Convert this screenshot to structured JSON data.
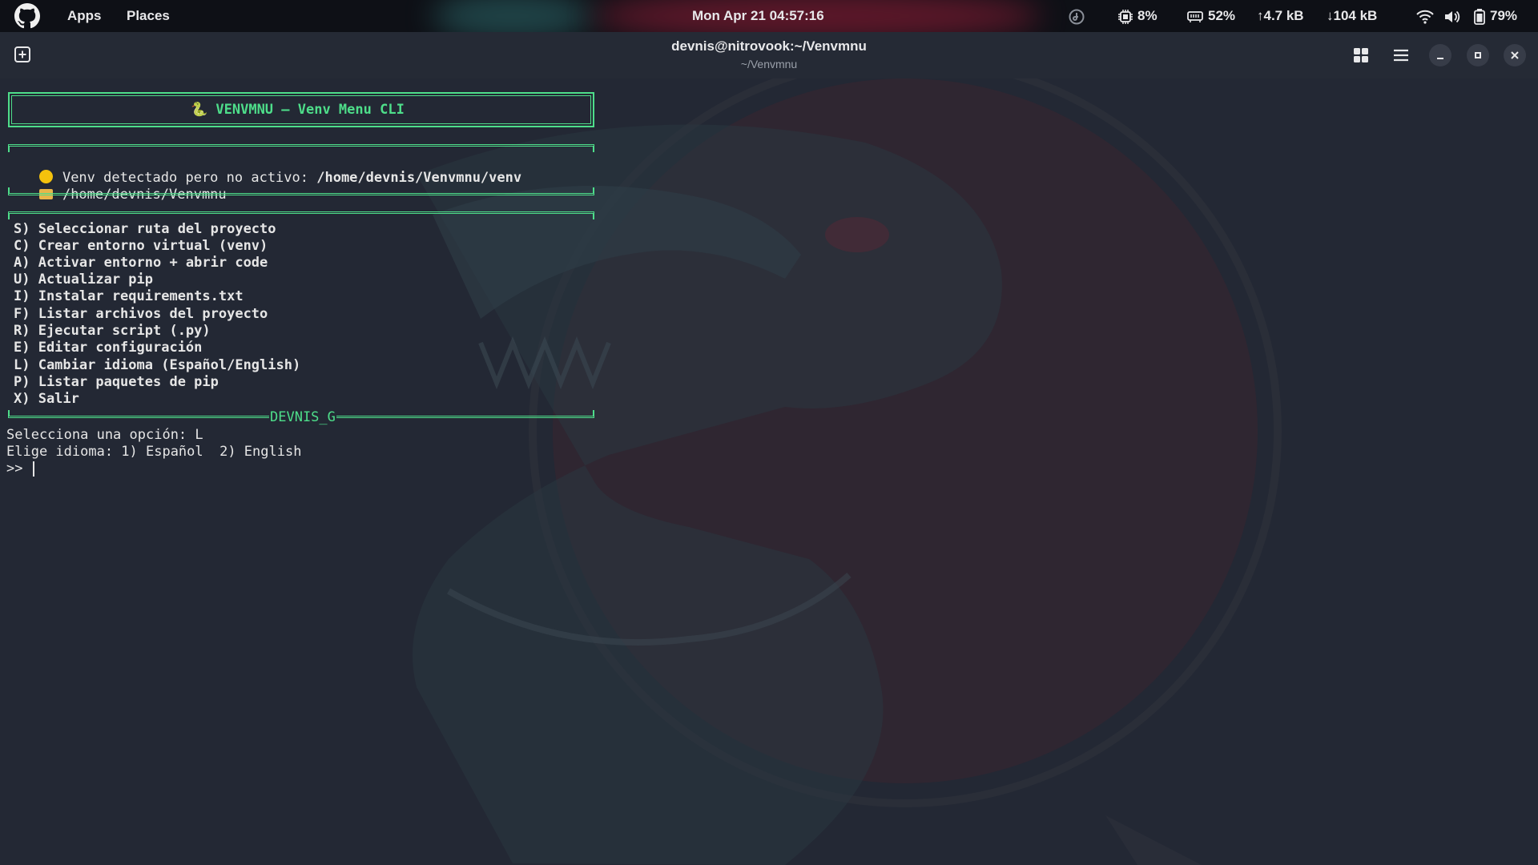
{
  "topbar": {
    "apps_label": "Apps",
    "places_label": "Places",
    "clock": "Mon Apr 21  04:57:16",
    "cpu": "8%",
    "memory": "52%",
    "upload": "4.7 kB",
    "download": "104 kB",
    "battery": "79%"
  },
  "window": {
    "title": "devnis@nitrovook:~/Venvmnu",
    "subtitle": "~/Venvmnu"
  },
  "terminal": {
    "banner": "🐍 VENVMNU – Venv Menu CLI",
    "status_prefix": "Venv detectado pero no activo: ",
    "status_path": "/home/devnis/Venvmnu/venv",
    "project_path": "/home/devnis/Venvmnu",
    "menu": [
      "S) Seleccionar ruta del proyecto",
      "C) Crear entorno virtual (venv)",
      "A) Activar entorno + abrir code",
      "U) Actualizar pip",
      "I) Instalar requirements.txt",
      "F) Listar archivos del proyecto",
      "R) Ejecutar script (.py)",
      "E) Editar configuración",
      "L) Cambiar idioma (Español/English)",
      "P) Listar paquetes de pip",
      "X) Salir"
    ],
    "footer_label": "DEVNIS_G",
    "prompt_line": "Selecciona una opción: L",
    "language_line": "Elige idioma: 1) Español  2) English",
    "input_prompt": ">> "
  },
  "colors": {
    "accent_green": "#4ede8a",
    "status_yellow": "#f4c20d",
    "folder_yellow": "#e8b64a"
  }
}
